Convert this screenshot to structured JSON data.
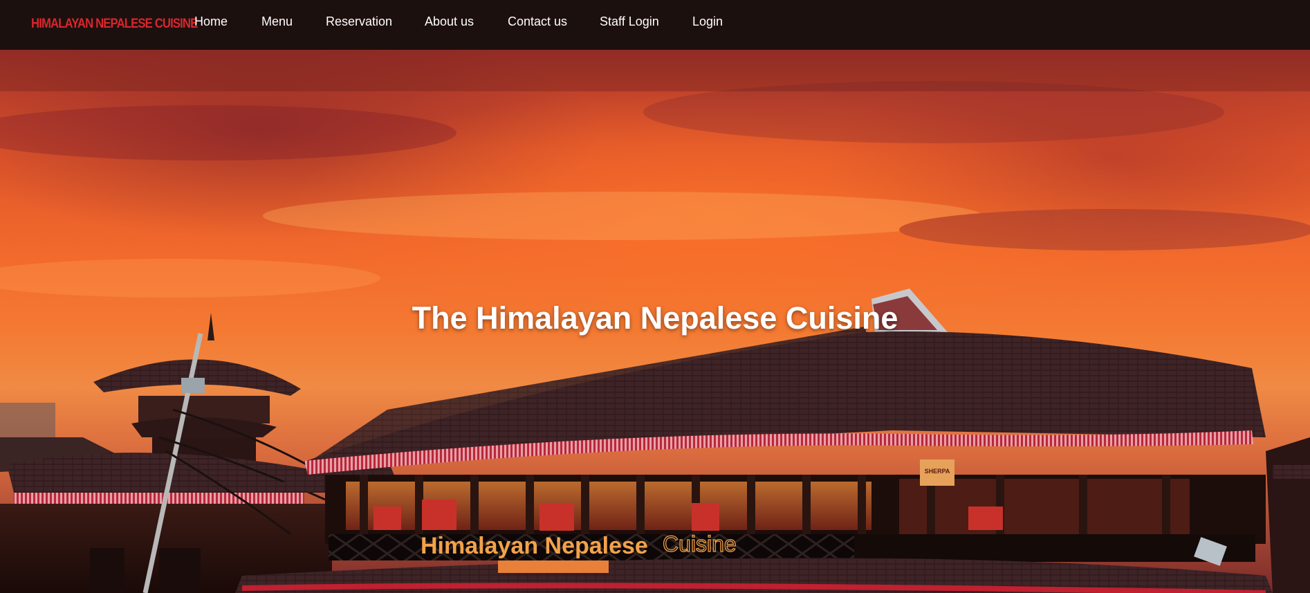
{
  "brand": {
    "logo_text": "HIMALAYAN NEPALESE CUISINE"
  },
  "nav": {
    "items": [
      {
        "label": "Home"
      },
      {
        "label": "Menu"
      },
      {
        "label": "Reservation"
      },
      {
        "label": "About us"
      },
      {
        "label": "Contact us"
      },
      {
        "label": "Staff Login"
      },
      {
        "label": "Login"
      }
    ]
  },
  "hero": {
    "title": "The Himalayan Nepalese Cuisine",
    "sign_text_primary": "Himalayan Nepalese",
    "sign_text_secondary": "Cuisine",
    "small_sign_text": "SHERPA"
  },
  "colors": {
    "navbar_bg": "#1c100f",
    "brand_red": "#d9262c",
    "nav_text": "#ffffff",
    "sign_orange": "#f2a24a"
  }
}
